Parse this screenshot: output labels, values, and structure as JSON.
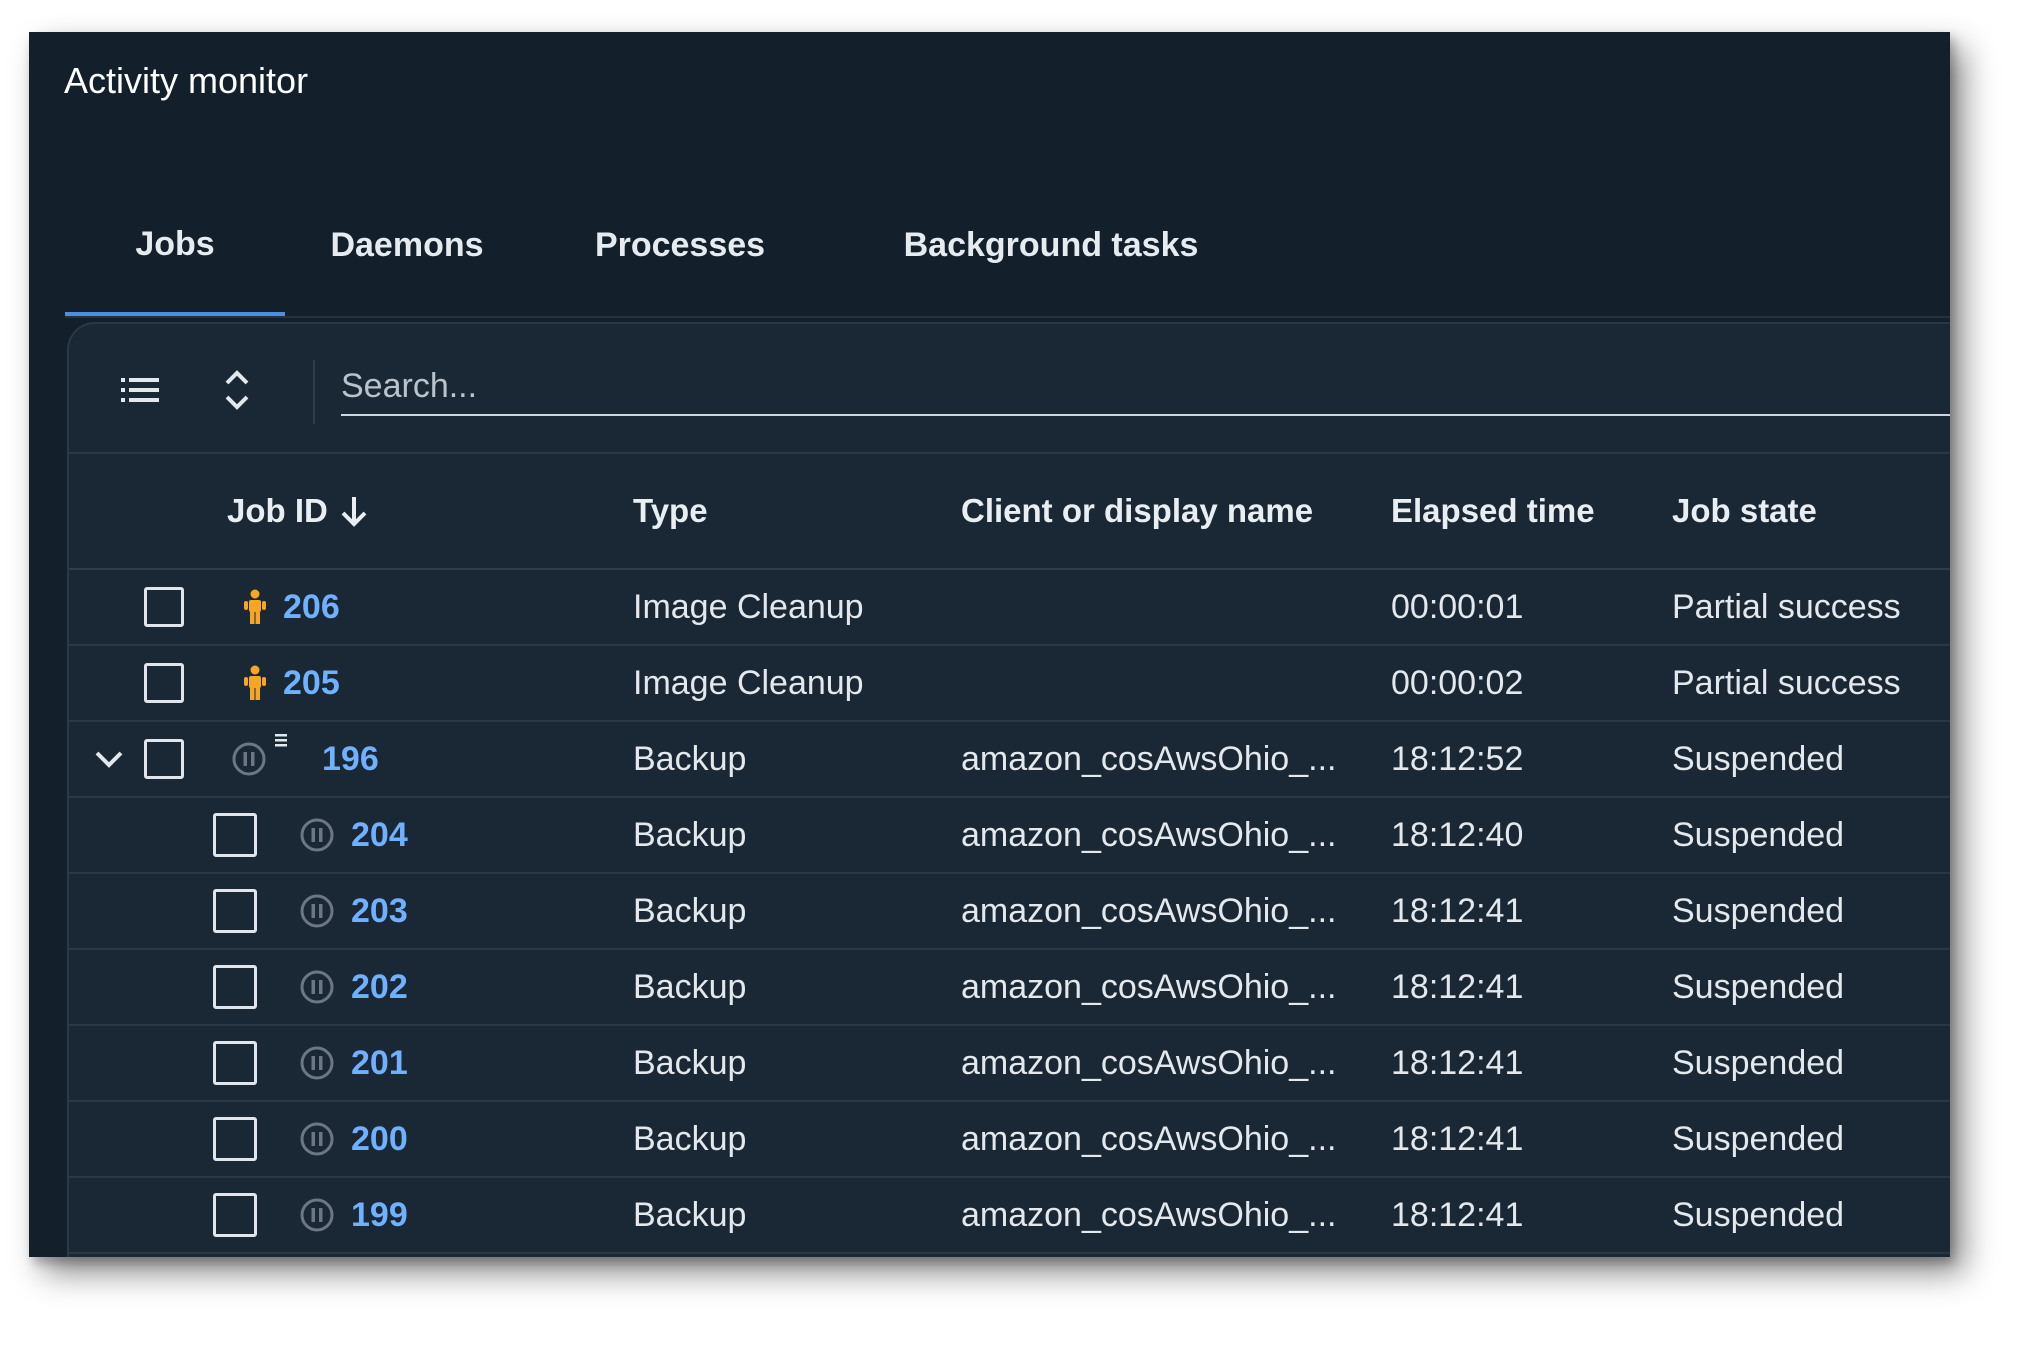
{
  "window": {
    "title": "Activity monitor"
  },
  "tabs": [
    {
      "label": "Jobs",
      "active": true
    },
    {
      "label": "Daemons",
      "active": false
    },
    {
      "label": "Processes",
      "active": false
    },
    {
      "label": "Background tasks",
      "active": false
    }
  ],
  "toolbar": {
    "list_icon": "list-icon",
    "expand_icon": "expand-collapse-icon",
    "search_placeholder": "Search..."
  },
  "table": {
    "columns": [
      {
        "label": "Job ID",
        "sort": "descending"
      },
      {
        "label": "Type"
      },
      {
        "label": "Client or display name"
      },
      {
        "label": "Elapsed time"
      },
      {
        "label": "Job state"
      }
    ],
    "rows": [
      {
        "job_id": "206",
        "type": "Image Cleanup",
        "client": "",
        "elapsed": "00:00:01",
        "state": "Partial success",
        "icon": "person-running-icon",
        "level": 0
      },
      {
        "job_id": "205",
        "type": "Image Cleanup",
        "client": "",
        "elapsed": "00:00:02",
        "state": "Partial success",
        "icon": "person-running-icon",
        "level": 0
      },
      {
        "job_id": "196",
        "type": "Backup",
        "client": "amazon_cosAwsOhio_...",
        "elapsed": "18:12:52",
        "state": "Suspended",
        "icon": "pause-circle-icon",
        "level": 0,
        "expanded": true,
        "parent": true
      },
      {
        "job_id": "204",
        "type": "Backup",
        "client": "amazon_cosAwsOhio_...",
        "elapsed": "18:12:40",
        "state": "Suspended",
        "icon": "pause-circle-icon",
        "level": 1
      },
      {
        "job_id": "203",
        "type": "Backup",
        "client": "amazon_cosAwsOhio_...",
        "elapsed": "18:12:41",
        "state": "Suspended",
        "icon": "pause-circle-icon",
        "level": 1
      },
      {
        "job_id": "202",
        "type": "Backup",
        "client": "amazon_cosAwsOhio_...",
        "elapsed": "18:12:41",
        "state": "Suspended",
        "icon": "pause-circle-icon",
        "level": 1
      },
      {
        "job_id": "201",
        "type": "Backup",
        "client": "amazon_cosAwsOhio_...",
        "elapsed": "18:12:41",
        "state": "Suspended",
        "icon": "pause-circle-icon",
        "level": 1
      },
      {
        "job_id": "200",
        "type": "Backup",
        "client": "amazon_cosAwsOhio_...",
        "elapsed": "18:12:41",
        "state": "Suspended",
        "icon": "pause-circle-icon",
        "level": 1
      },
      {
        "job_id": "199",
        "type": "Backup",
        "client": "amazon_cosAwsOhio_...",
        "elapsed": "18:12:41",
        "state": "Suspended",
        "icon": "pause-circle-icon",
        "level": 1
      }
    ]
  },
  "colors": {
    "background": "#13202c",
    "panel": "#1a2734",
    "accent": "#4a90e2",
    "link": "#6fb0ff",
    "running": "#f5a623",
    "suspended": "#6b7782"
  }
}
